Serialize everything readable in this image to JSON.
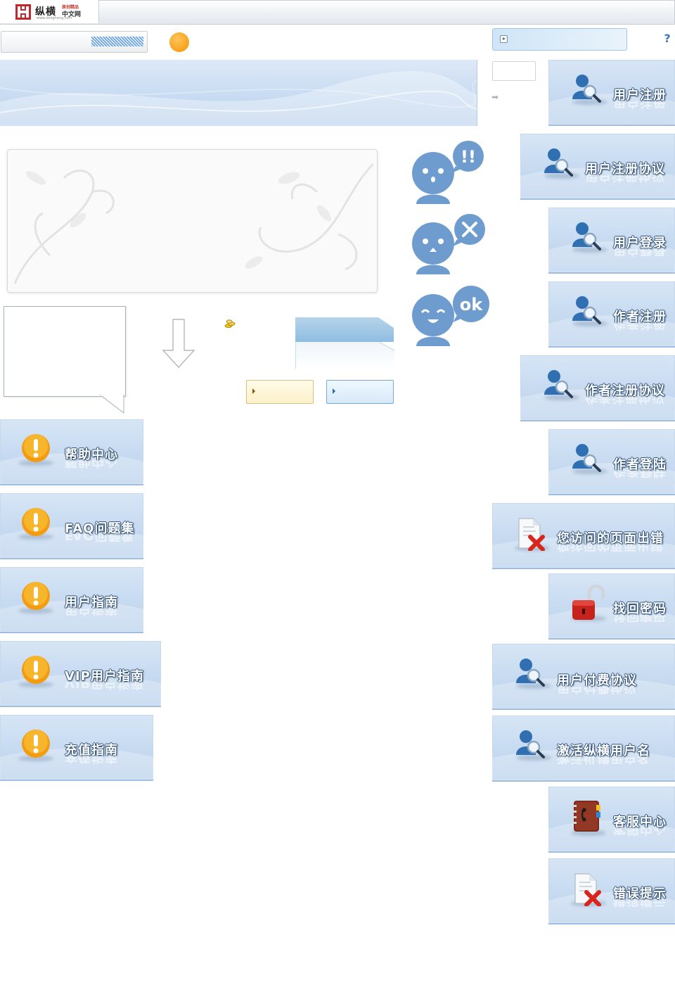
{
  "header": {
    "brand_name": "纵横",
    "brand_tag": "原创精品",
    "brand_sub": "中文网",
    "brand_url": "www.zongheng.com"
  },
  "colors": {
    "tile_blue": "#c9dcf1",
    "label_outline": "#2d4f76",
    "orange": "#f7a21b",
    "face_blue": "#6f9ccf",
    "user_icon_blue": "#2f6fb2"
  },
  "faces": [
    {
      "icon": "alarm-face-icon",
      "badge": "!!"
    },
    {
      "icon": "error-face-icon",
      "badge": "×"
    },
    {
      "icon": "ok-face-icon",
      "badge": "ok"
    }
  ],
  "right_tiles": [
    {
      "label": "用户注册",
      "icon": "user-search-icon"
    },
    {
      "label": "用户注册协议",
      "icon": "user-search-icon"
    },
    {
      "label": "用户登录",
      "icon": "user-search-icon"
    },
    {
      "label": "作者注册",
      "icon": "user-search-icon"
    },
    {
      "label": "作者注册协议",
      "icon": "user-search-icon"
    },
    {
      "label": "作者登陆",
      "icon": "user-search-icon"
    },
    {
      "label": "您访问的页面出错",
      "icon": "page-error-icon"
    },
    {
      "label": "找回密码",
      "icon": "padlock-icon"
    },
    {
      "label": "用户付费协议",
      "icon": "user-search-icon"
    },
    {
      "label": "激活纵横用户名",
      "icon": "user-search-icon"
    },
    {
      "label": "客服中心",
      "icon": "phone-book-icon"
    },
    {
      "label": "错误提示",
      "icon": "page-error-icon"
    }
  ],
  "left_tiles": [
    {
      "label": "帮助中心",
      "icon": "warning-icon"
    },
    {
      "label": "FAQ问题集",
      "icon": "warning-icon"
    },
    {
      "label": "用户指南",
      "icon": "warning-icon"
    },
    {
      "label": "VIP用户指南",
      "icon": "warning-icon"
    },
    {
      "label": "充值指南",
      "icon": "warning-icon"
    }
  ]
}
